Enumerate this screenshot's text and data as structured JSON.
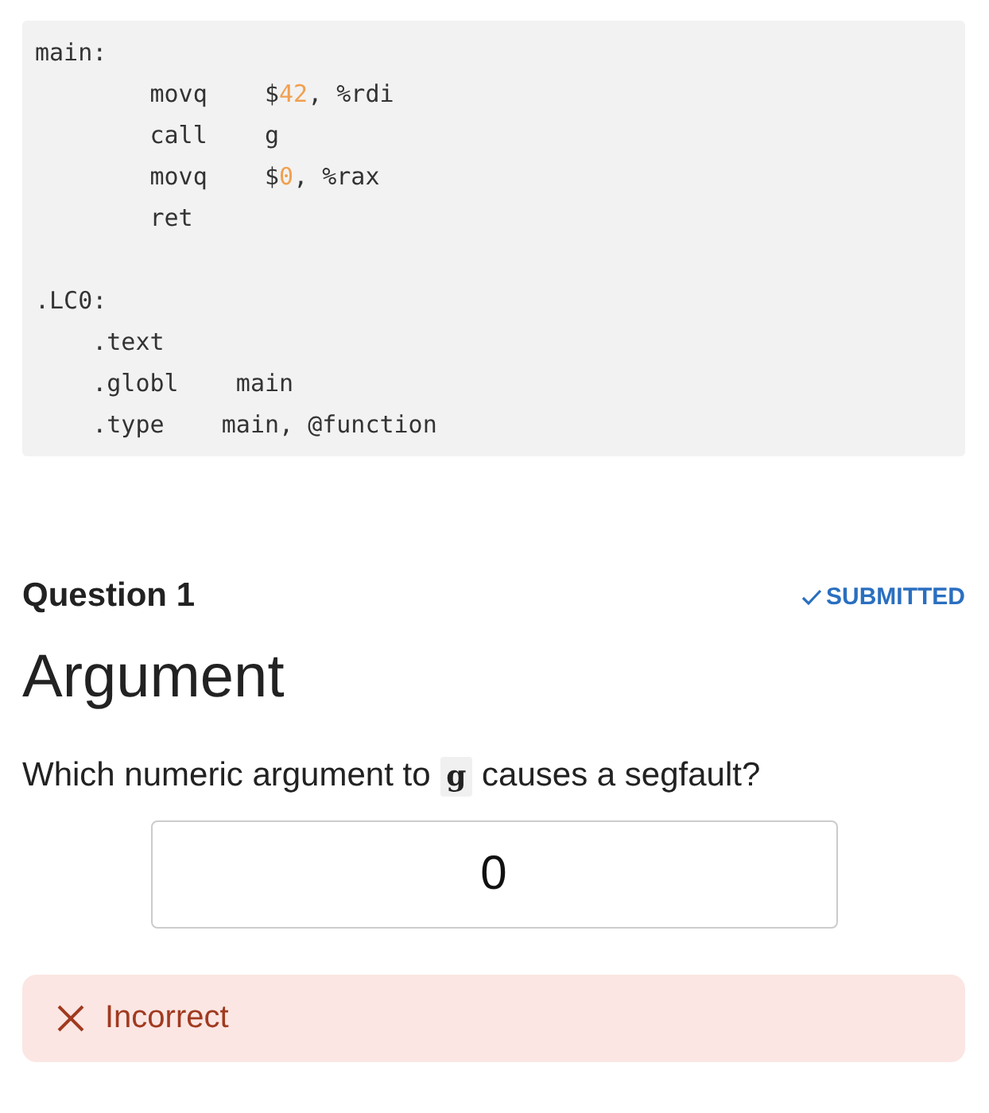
{
  "code_block": {
    "lines": [
      [
        {
          "text": "main:",
          "kind": "plain"
        }
      ],
      [
        {
          "text": "        movq    $",
          "kind": "plain"
        },
        {
          "text": "42",
          "kind": "number"
        },
        {
          "text": ", %rdi",
          "kind": "plain"
        }
      ],
      [
        {
          "text": "        call    g",
          "kind": "plain"
        }
      ],
      [
        {
          "text": "        movq    $",
          "kind": "plain"
        },
        {
          "text": "0",
          "kind": "number"
        },
        {
          "text": ", %rax",
          "kind": "plain"
        }
      ],
      [
        {
          "text": "        ret",
          "kind": "plain"
        }
      ],
      [
        {
          "kind": "blank"
        }
      ],
      [
        {
          "text": ".LC0:",
          "kind": "plain"
        }
      ],
      [
        {
          "text": "    .text",
          "kind": "plain"
        }
      ],
      [
        {
          "text": "    .globl    main",
          "kind": "plain"
        }
      ],
      [
        {
          "text": "    .type    main, @function",
          "kind": "plain"
        }
      ]
    ]
  },
  "question": {
    "label": "Question 1",
    "status": {
      "text": "SUBMITTED",
      "submitted": true
    },
    "title": "Argument",
    "prompt": [
      {
        "text": "Which numeric argument to ",
        "kind": "text"
      },
      {
        "text": "g",
        "kind": "code"
      },
      {
        "text": " causes a segfault?",
        "kind": "text"
      }
    ],
    "answer": {
      "value": "0"
    },
    "feedback": {
      "kind": "incorrect",
      "text": "Incorrect"
    }
  }
}
